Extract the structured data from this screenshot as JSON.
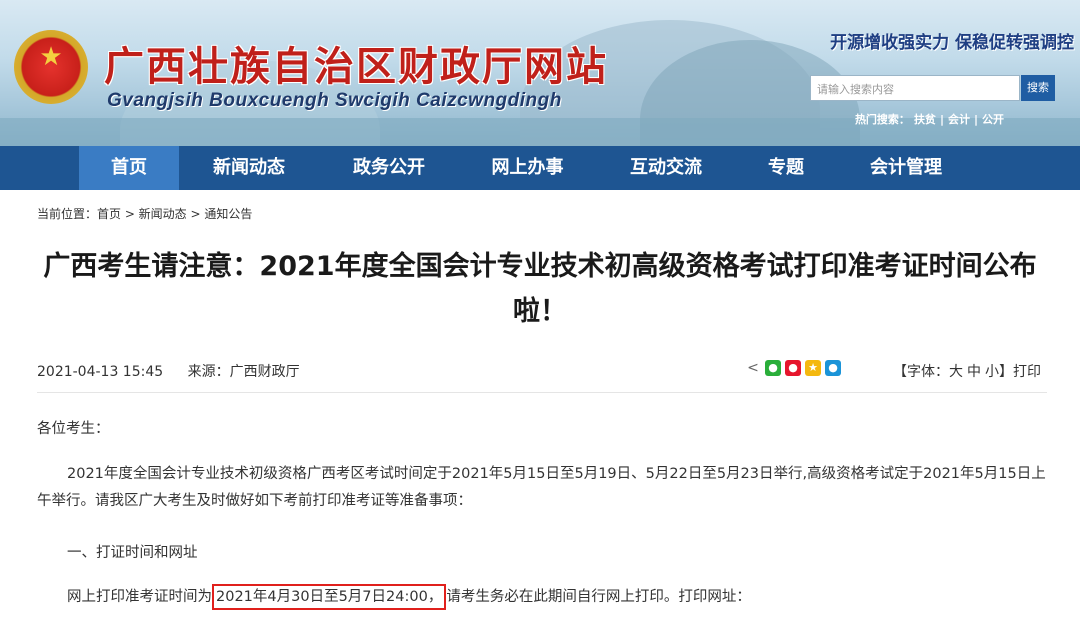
{
  "header": {
    "site_title": "广西壮族自治区财政厅网站",
    "site_subtitle": "Gvangjsih Bouxcuengh Swcigih Caizcwngdingh",
    "slogan": "开源增收强实力  保稳促转强调控",
    "search_placeholder": "请输入搜索内容",
    "search_button": "搜索",
    "hot_label": "热门搜索：",
    "hot_terms": [
      "扶贫",
      "会计",
      "公开"
    ],
    "hot_sep": "|"
  },
  "nav": {
    "items": [
      "首页",
      "新闻动态",
      "政务公开",
      "网上办事",
      "互动交流",
      "专题",
      "会计管理"
    ],
    "active_index": 0
  },
  "breadcrumb": "当前位置：首页 > 新闻动态 > 通知公告",
  "article": {
    "title": "广西考生请注意：2021年度全国会计专业技术初高级资格考试打印准考证时间公布啦！",
    "datetime": "2021-04-13 15:45",
    "source": "来源：广西财政厅",
    "share_icons": [
      "share-icon",
      "wechat-icon",
      "weibo-icon",
      "qzone-icon",
      "qq-icon"
    ],
    "font_label": "【字体：",
    "font_sizes": [
      "大",
      "中",
      "小"
    ],
    "font_end": "】",
    "print": "打印",
    "greeting": "各位考生：",
    "intro": "2021年度全国会计专业技术初级资格广西考区考试时间定于2021年5月15日至5月19日、5月22日至5月23日举行,高级资格考试定于2021年5月15日上午举行。请我区广大考生及时做好如下考前打印准考证等准备事项：",
    "section1": "一、打证时间和网址",
    "time_prefix": "网上打印准考证时间为",
    "time_highlight": "2021年4月30日至5月7日24:00，",
    "time_suffix": "请考生务必在此期间自行网上打印。打印网址："
  },
  "colors": {
    "nav_bg": "#1e5592",
    "nav_active": "#3a7cc4",
    "title_red": "#c0201a",
    "highlight_border": "#e0201c"
  }
}
